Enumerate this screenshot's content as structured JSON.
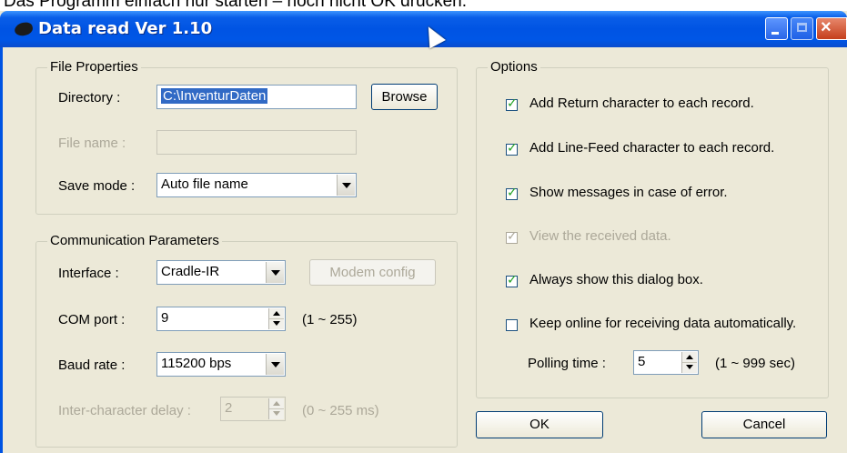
{
  "caption": "Das Programm einfach nur starten – noch nicht OK drücken.",
  "window": {
    "title": "Data read  Ver 1.10",
    "min_glyph": "",
    "max_glyph": "",
    "close_glyph": "×"
  },
  "file_properties": {
    "group_label": "File Properties",
    "directory_label": "Directory :",
    "directory_value": "C:\\InventurDaten",
    "browse_label": "Browse",
    "filename_label": "File name :",
    "filename_value": "",
    "save_mode_label": "Save mode :",
    "save_mode_value": "Auto file name"
  },
  "communication": {
    "group_label": "Communication Parameters",
    "interface_label": "Interface :",
    "interface_value": "Cradle-IR",
    "modem_config_label": "Modem config",
    "com_port_label": "COM port :",
    "com_port_value": "9",
    "com_port_range": "(1 ~ 255)",
    "baud_rate_label": "Baud rate :",
    "baud_rate_value": "115200 bps",
    "delay_label": "Inter-character delay :",
    "delay_value": "2",
    "delay_range": "(0 ~ 255 ms)"
  },
  "options": {
    "group_label": "Options",
    "items": [
      {
        "label": "Add Return character to each record.",
        "checked": true,
        "enabled": true
      },
      {
        "label": "Add Line-Feed character to each record.",
        "checked": true,
        "enabled": true
      },
      {
        "label": "Show messages in case of error.",
        "checked": true,
        "enabled": true
      },
      {
        "label": "View the received data.",
        "checked": true,
        "enabled": false
      },
      {
        "label": "Always show this dialog box.",
        "checked": true,
        "enabled": true
      },
      {
        "label": "Keep online for receiving data automatically.",
        "checked": false,
        "enabled": true
      }
    ],
    "polling_label": "Polling time :",
    "polling_value": "5",
    "polling_range": "(1 ~ 999 sec)"
  },
  "buttons": {
    "ok_label": "OK",
    "cancel_label": "Cancel"
  }
}
